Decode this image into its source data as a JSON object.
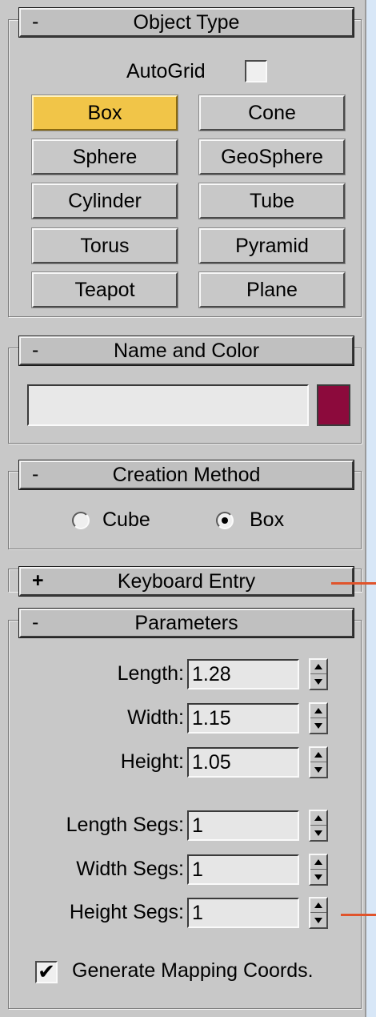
{
  "object_type": {
    "collapse_sign": "-",
    "title": "Object Type",
    "autogrid_label": "AutoGrid",
    "autogrid_checked": false,
    "buttons": [
      "Box",
      "Cone",
      "Sphere",
      "GeoSphere",
      "Cylinder",
      "Tube",
      "Torus",
      "Pyramid",
      "Teapot",
      "Plane"
    ],
    "active_button": "Box",
    "active_color": "#f1c548"
  },
  "name_color": {
    "collapse_sign": "-",
    "title": "Name and Color",
    "name_value": "",
    "swatch_color": "#8c0a3c"
  },
  "creation_method": {
    "collapse_sign": "-",
    "title": "Creation Method",
    "options": [
      "Cube",
      "Box"
    ],
    "selected": "Box"
  },
  "keyboard_entry": {
    "expand_sign": "+",
    "title": "Keyboard Entry"
  },
  "parameters": {
    "collapse_sign": "-",
    "title": "Parameters",
    "length_label": "Length:",
    "length_value": "1.28",
    "width_label": "Width:",
    "width_value": "1.15",
    "height_label": "Height:",
    "height_value": "1.05",
    "length_segs_label": "Length Segs:",
    "length_segs_value": "1",
    "width_segs_label": "Width Segs:",
    "width_segs_value": "1",
    "height_segs_label": "Height Segs:",
    "height_segs_value": "1",
    "mapping_label": "Generate Mapping Coords.",
    "mapping_checked": true
  },
  "annotation_color": "#e0542c"
}
